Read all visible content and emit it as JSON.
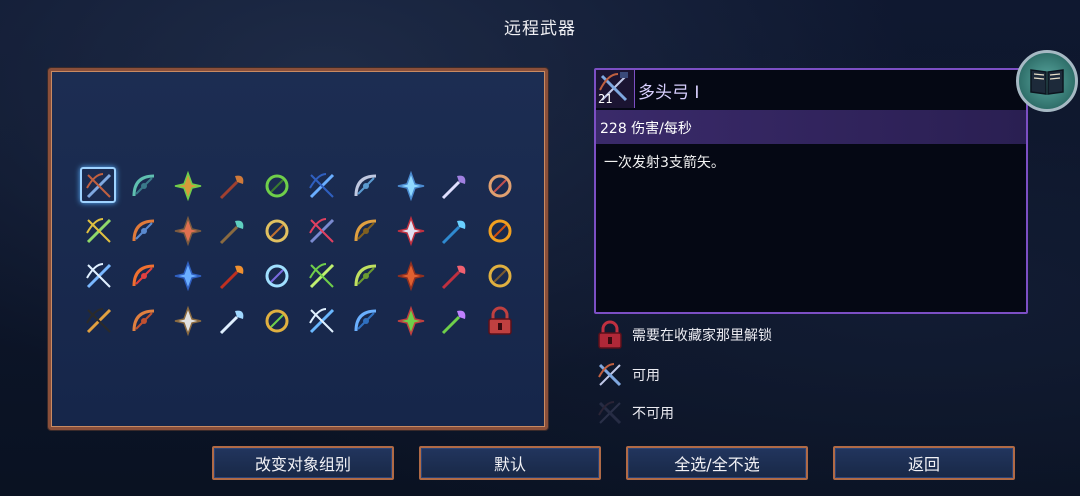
{
  "screen": {
    "title": "远程武器"
  },
  "info": {
    "weapon_name": "多头弓 I",
    "count": "21",
    "stat": "228 伤害/每秒",
    "description": "一次发射3支箭矢。",
    "book_icon": "book-icon"
  },
  "legend": [
    {
      "icon": "lock-icon",
      "label": "需要在收藏家那里解锁"
    },
    {
      "icon": "crossbow-available-icon",
      "label": "可用"
    },
    {
      "icon": "crossbow-unavailable-icon",
      "label": "不可用"
    }
  ],
  "buttons": {
    "change_group": "改变对象组别",
    "default": "默认",
    "select_all": "全选/全不选",
    "back": "返回"
  },
  "weapons": [
    {
      "name": "multiple-nocks-bow-icon",
      "color": "#7fa8e0",
      "accent": "#c06040",
      "selected": true
    },
    {
      "name": "heavy-crossbow-icon",
      "color": "#5fbfb0",
      "accent": "#3a7a8a"
    },
    {
      "name": "poison-bow-icon",
      "color": "#d89a3a",
      "accent": "#6fcf4a"
    },
    {
      "name": "fire-bow-icon",
      "color": "#d07a3a",
      "accent": "#a04030"
    },
    {
      "name": "nature-bow-icon",
      "color": "#6fcf4a",
      "accent": "#3a7a30"
    },
    {
      "name": "ice-bow-icon",
      "color": "#6aaeff",
      "accent": "#2f5fc0"
    },
    {
      "name": "repeater-crossbow-icon",
      "color": "#c0c8e0",
      "accent": "#5a9ad0"
    },
    {
      "name": "ice-crossbow-icon",
      "color": "#8fd8ff",
      "accent": "#4a8ad0"
    },
    {
      "name": "magic-bow-icon",
      "color": "#a080e0",
      "accent": "#e0e0ff"
    },
    {
      "name": "infantry-bow-icon",
      "color": "#e0a070",
      "accent": "#c05050"
    },
    {
      "name": "spike-turret-icon",
      "color": "#8fd86a",
      "accent": "#e0c040"
    },
    {
      "name": "boomerang-icon",
      "color": "#e07a3a",
      "accent": "#5a8ad0"
    },
    {
      "name": "throwing-pickaxe-icon",
      "color": "#e07050",
      "accent": "#7a5a40"
    },
    {
      "name": "throwing-axe-icon",
      "color": "#5fcfc0",
      "accent": "#8a6a40"
    },
    {
      "name": "throwing-knife-icon",
      "color": "#e0c060",
      "accent": "#c07030"
    },
    {
      "name": "gilded-crossbow-icon",
      "color": "#7a8ad0",
      "accent": "#e04060"
    },
    {
      "name": "gold-bow-icon",
      "color": "#e0a040",
      "accent": "#806020"
    },
    {
      "name": "spear-icon",
      "color": "#e0e0f0",
      "accent": "#c03040"
    },
    {
      "name": "electric-whip-icon",
      "color": "#6ad0ff",
      "accent": "#2f8ad0"
    },
    {
      "name": "fire-ring-icon",
      "color": "#f0a020",
      "accent": "#d05010"
    },
    {
      "name": "ice-shards-icon",
      "color": "#7ab8ff",
      "accent": "#e0f0ff"
    },
    {
      "name": "fire-blast-icon",
      "color": "#f07030",
      "accent": "#e04040"
    },
    {
      "name": "lightning-bolt-icon",
      "color": "#6aaeff",
      "accent": "#2f5fc0"
    },
    {
      "name": "fire-brand-icon",
      "color": "#f09030",
      "accent": "#c03020"
    },
    {
      "name": "ice-crystal-icon",
      "color": "#a0e0ff",
      "accent": "#7a6ae0"
    },
    {
      "name": "acid-blast-icon",
      "color": "#c0f070",
      "accent": "#6fcf4a"
    },
    {
      "name": "magic-wand-icon",
      "color": "#c0e060",
      "accent": "#6a9a30"
    },
    {
      "name": "fire-claw-icon",
      "color": "#e06030",
      "accent": "#903020"
    },
    {
      "name": "card-deck-icon",
      "color": "#f06070",
      "accent": "#c03040"
    },
    {
      "name": "hunter-bow-icon",
      "color": "#e0b040",
      "accent": "#7a5a30"
    },
    {
      "name": "bomb-bag-icon",
      "color": "#e0a040",
      "accent": "#2a2a2a"
    },
    {
      "name": "recurve-bow-icon",
      "color": "#e08040",
      "accent": "#c05030"
    },
    {
      "name": "cleaver-icon",
      "color": "#e0e0e0",
      "accent": "#8a6a40"
    },
    {
      "name": "ice-hook-icon",
      "color": "#a0d8ff",
      "accent": "#e0f0ff"
    },
    {
      "name": "lantern-icon",
      "color": "#e0b040",
      "accent": "#6fcf4a"
    },
    {
      "name": "cross-shuriken-icon",
      "color": "#6ab8ff",
      "accent": "#e0f0ff"
    },
    {
      "name": "ice-ring-icon",
      "color": "#6ab0ff",
      "accent": "#2f70c0"
    },
    {
      "name": "vine-whip-icon",
      "color": "#6fcf4a",
      "accent": "#c04040"
    },
    {
      "name": "eye-orb-icon",
      "color": "#c080ff",
      "accent": "#6fcf4a"
    },
    {
      "name": "locked-weapon-icon",
      "color": "#c04040",
      "accent": "#e0b060",
      "locked": true
    }
  ]
}
